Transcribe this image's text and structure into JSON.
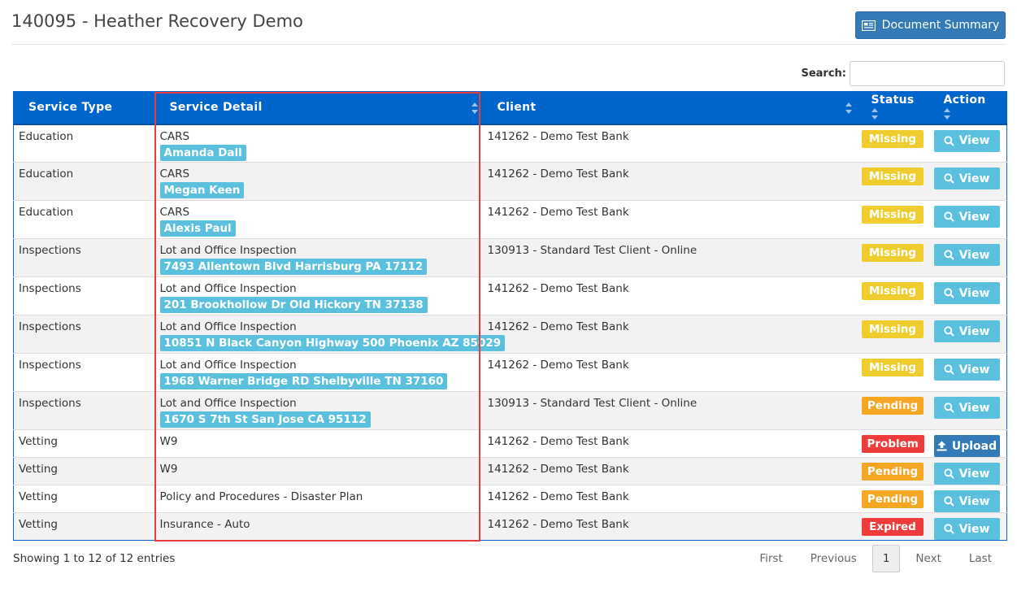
{
  "page": {
    "title": "140095 - Heather Recovery Demo",
    "document_summary_label": "Document Summary"
  },
  "search": {
    "label": "Search:",
    "value": "",
    "placeholder": ""
  },
  "table": {
    "headers": {
      "service_type": "Service Type",
      "service_detail": "Service Detail",
      "client": "Client",
      "status": "Status",
      "action": "Action"
    },
    "rows": [
      {
        "service_type": "Education",
        "detail": "CARS",
        "tag": "Amanda Dall",
        "client": "141262 - Demo Test Bank",
        "status": "Missing",
        "status_color": "#f0cd2e",
        "action": "View",
        "action_icon": "search-icon"
      },
      {
        "service_type": "Education",
        "detail": "CARS",
        "tag": "Megan Keen",
        "client": "141262 - Demo Test Bank",
        "status": "Missing",
        "status_color": "#f0cd2e",
        "action": "View",
        "action_icon": "search-icon"
      },
      {
        "service_type": "Education",
        "detail": "CARS",
        "tag": "Alexis Paul",
        "client": "141262 - Demo Test Bank",
        "status": "Missing",
        "status_color": "#f0cd2e",
        "action": "View",
        "action_icon": "search-icon"
      },
      {
        "service_type": "Inspections",
        "detail": "Lot and Office Inspection",
        "tag": "7493 Allentown Blvd Harrisburg PA 17112",
        "client": "130913 - Standard Test Client - Online",
        "status": "Missing",
        "status_color": "#f0cd2e",
        "action": "View",
        "action_icon": "search-icon"
      },
      {
        "service_type": "Inspections",
        "detail": "Lot and Office Inspection",
        "tag": "201 Brookhollow Dr Old Hickory TN 37138",
        "client": "141262 - Demo Test Bank",
        "status": "Missing",
        "status_color": "#f0cd2e",
        "action": "View",
        "action_icon": "search-icon"
      },
      {
        "service_type": "Inspections",
        "detail": "Lot and Office Inspection",
        "tag": "10851 N Black Canyon Highway 500 Phoenix AZ 85029",
        "client": "141262 - Demo Test Bank",
        "status": "Missing",
        "status_color": "#f0cd2e",
        "action": "View",
        "action_icon": "search-icon"
      },
      {
        "service_type": "Inspections",
        "detail": "Lot and Office Inspection",
        "tag": "1968 Warner Bridge RD Shelbyville TN 37160",
        "client": "141262 - Demo Test Bank",
        "status": "Missing",
        "status_color": "#f0cd2e",
        "action": "View",
        "action_icon": "search-icon"
      },
      {
        "service_type": "Inspections",
        "detail": "Lot and Office Inspection",
        "tag": "1670 S 7th St San Jose CA 95112",
        "client": "130913 - Standard Test Client - Online",
        "status": "Pending",
        "status_color": "#f5a623",
        "action": "View",
        "action_icon": "search-icon"
      },
      {
        "service_type": "Vetting",
        "detail": "W9",
        "tag": null,
        "client": "141262 - Demo Test Bank",
        "status": "Problem",
        "status_color": "#ee3b3b",
        "action": "Upload",
        "action_icon": "upload-icon"
      },
      {
        "service_type": "Vetting",
        "detail": "W9",
        "tag": null,
        "client": "141262 - Demo Test Bank",
        "status": "Pending",
        "status_color": "#f5a623",
        "action": "View",
        "action_icon": "search-icon"
      },
      {
        "service_type": "Vetting",
        "detail": "Policy and Procedures - Disaster Plan",
        "tag": null,
        "client": "141262 - Demo Test Bank",
        "status": "Pending",
        "status_color": "#f5a623",
        "action": "View",
        "action_icon": "search-icon"
      },
      {
        "service_type": "Vetting",
        "detail": "Insurance - Auto",
        "tag": null,
        "client": "141262 - Demo Test Bank",
        "status": "Expired",
        "status_color": "#ee3b3b",
        "action": "View",
        "action_icon": "search-icon"
      }
    ]
  },
  "footer": {
    "info": "Showing 1 to 12 of 12 entries",
    "pagination": {
      "first": "First",
      "previous": "Previous",
      "current": "1",
      "next": "Next",
      "last": "Last"
    }
  },
  "colors": {
    "header_blue": "#0066cc",
    "primary": "#337ab7",
    "info": "#5bc0de",
    "highlight_border": "#e53d3d"
  }
}
